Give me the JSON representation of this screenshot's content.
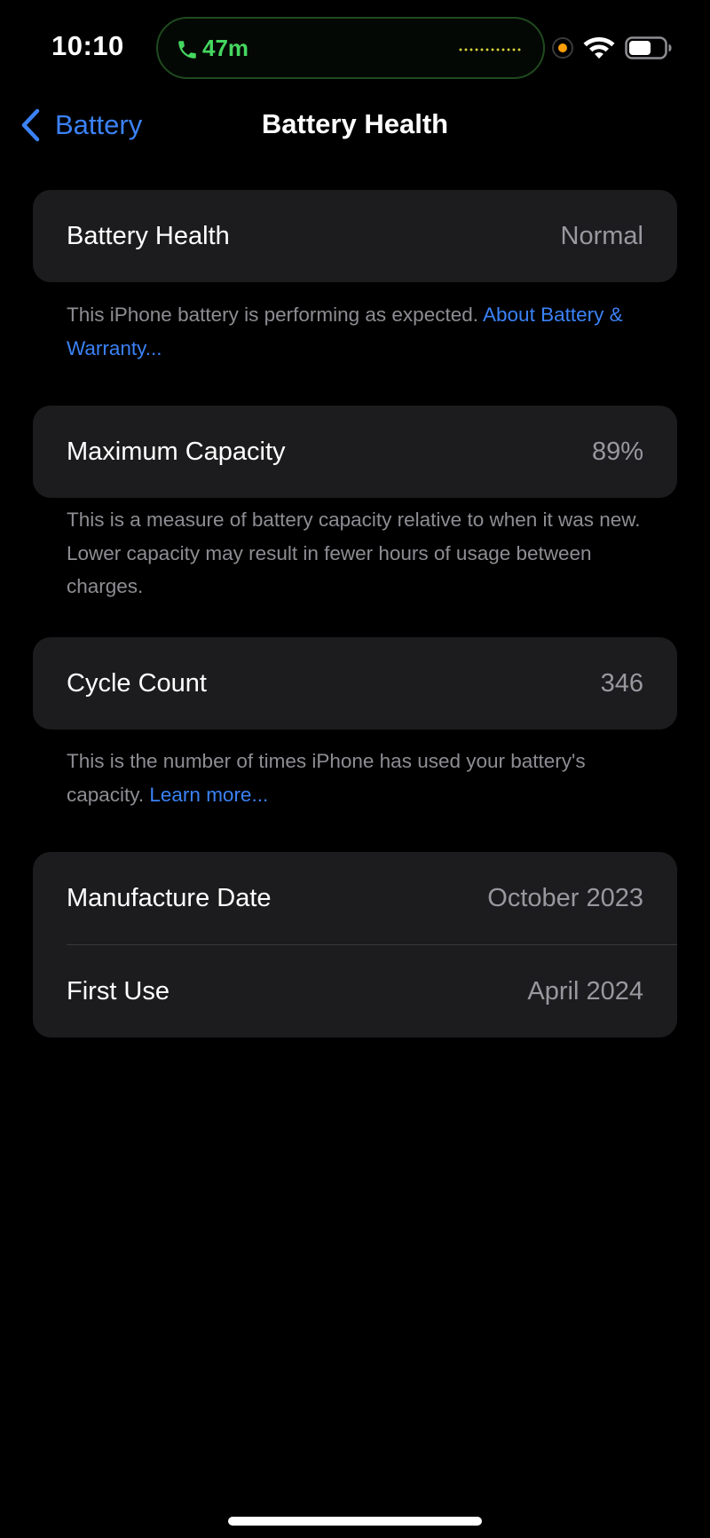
{
  "status_bar": {
    "time": "10:10",
    "call_duration": "47m",
    "icons": [
      "phone-icon",
      "waveform-icon",
      "mic-indicator",
      "wifi-icon",
      "battery-icon"
    ],
    "call_color": "#45d760",
    "mic_indicator_color": "#ff9f0a"
  },
  "nav": {
    "back_label": "Battery",
    "title": "Battery Health"
  },
  "sections": {
    "health": {
      "label": "Battery Health",
      "value": "Normal",
      "footnote_text": "This iPhone battery is performing as expected.",
      "footnote_link": "About Battery & Warranty..."
    },
    "capacity": {
      "label": "Maximum Capacity",
      "value": "89%",
      "footnote_text": "This is a measure of battery capacity relative to when it was new. Lower capacity may result in fewer hours of usage between charges."
    },
    "cycles": {
      "label": "Cycle Count",
      "value": "346",
      "footnote_text": "This is the number of times iPhone has used your battery's capacity.",
      "footnote_link": "Learn more..."
    },
    "dates": {
      "manufacture_label": "Manufacture Date",
      "manufacture_value": "October 2023",
      "first_use_label": "First Use",
      "first_use_value": "April 2024"
    }
  },
  "colors": {
    "background": "#000000",
    "card": "#1c1c1e",
    "accent_link": "#3b82f6",
    "secondary_text": "#98989f"
  }
}
